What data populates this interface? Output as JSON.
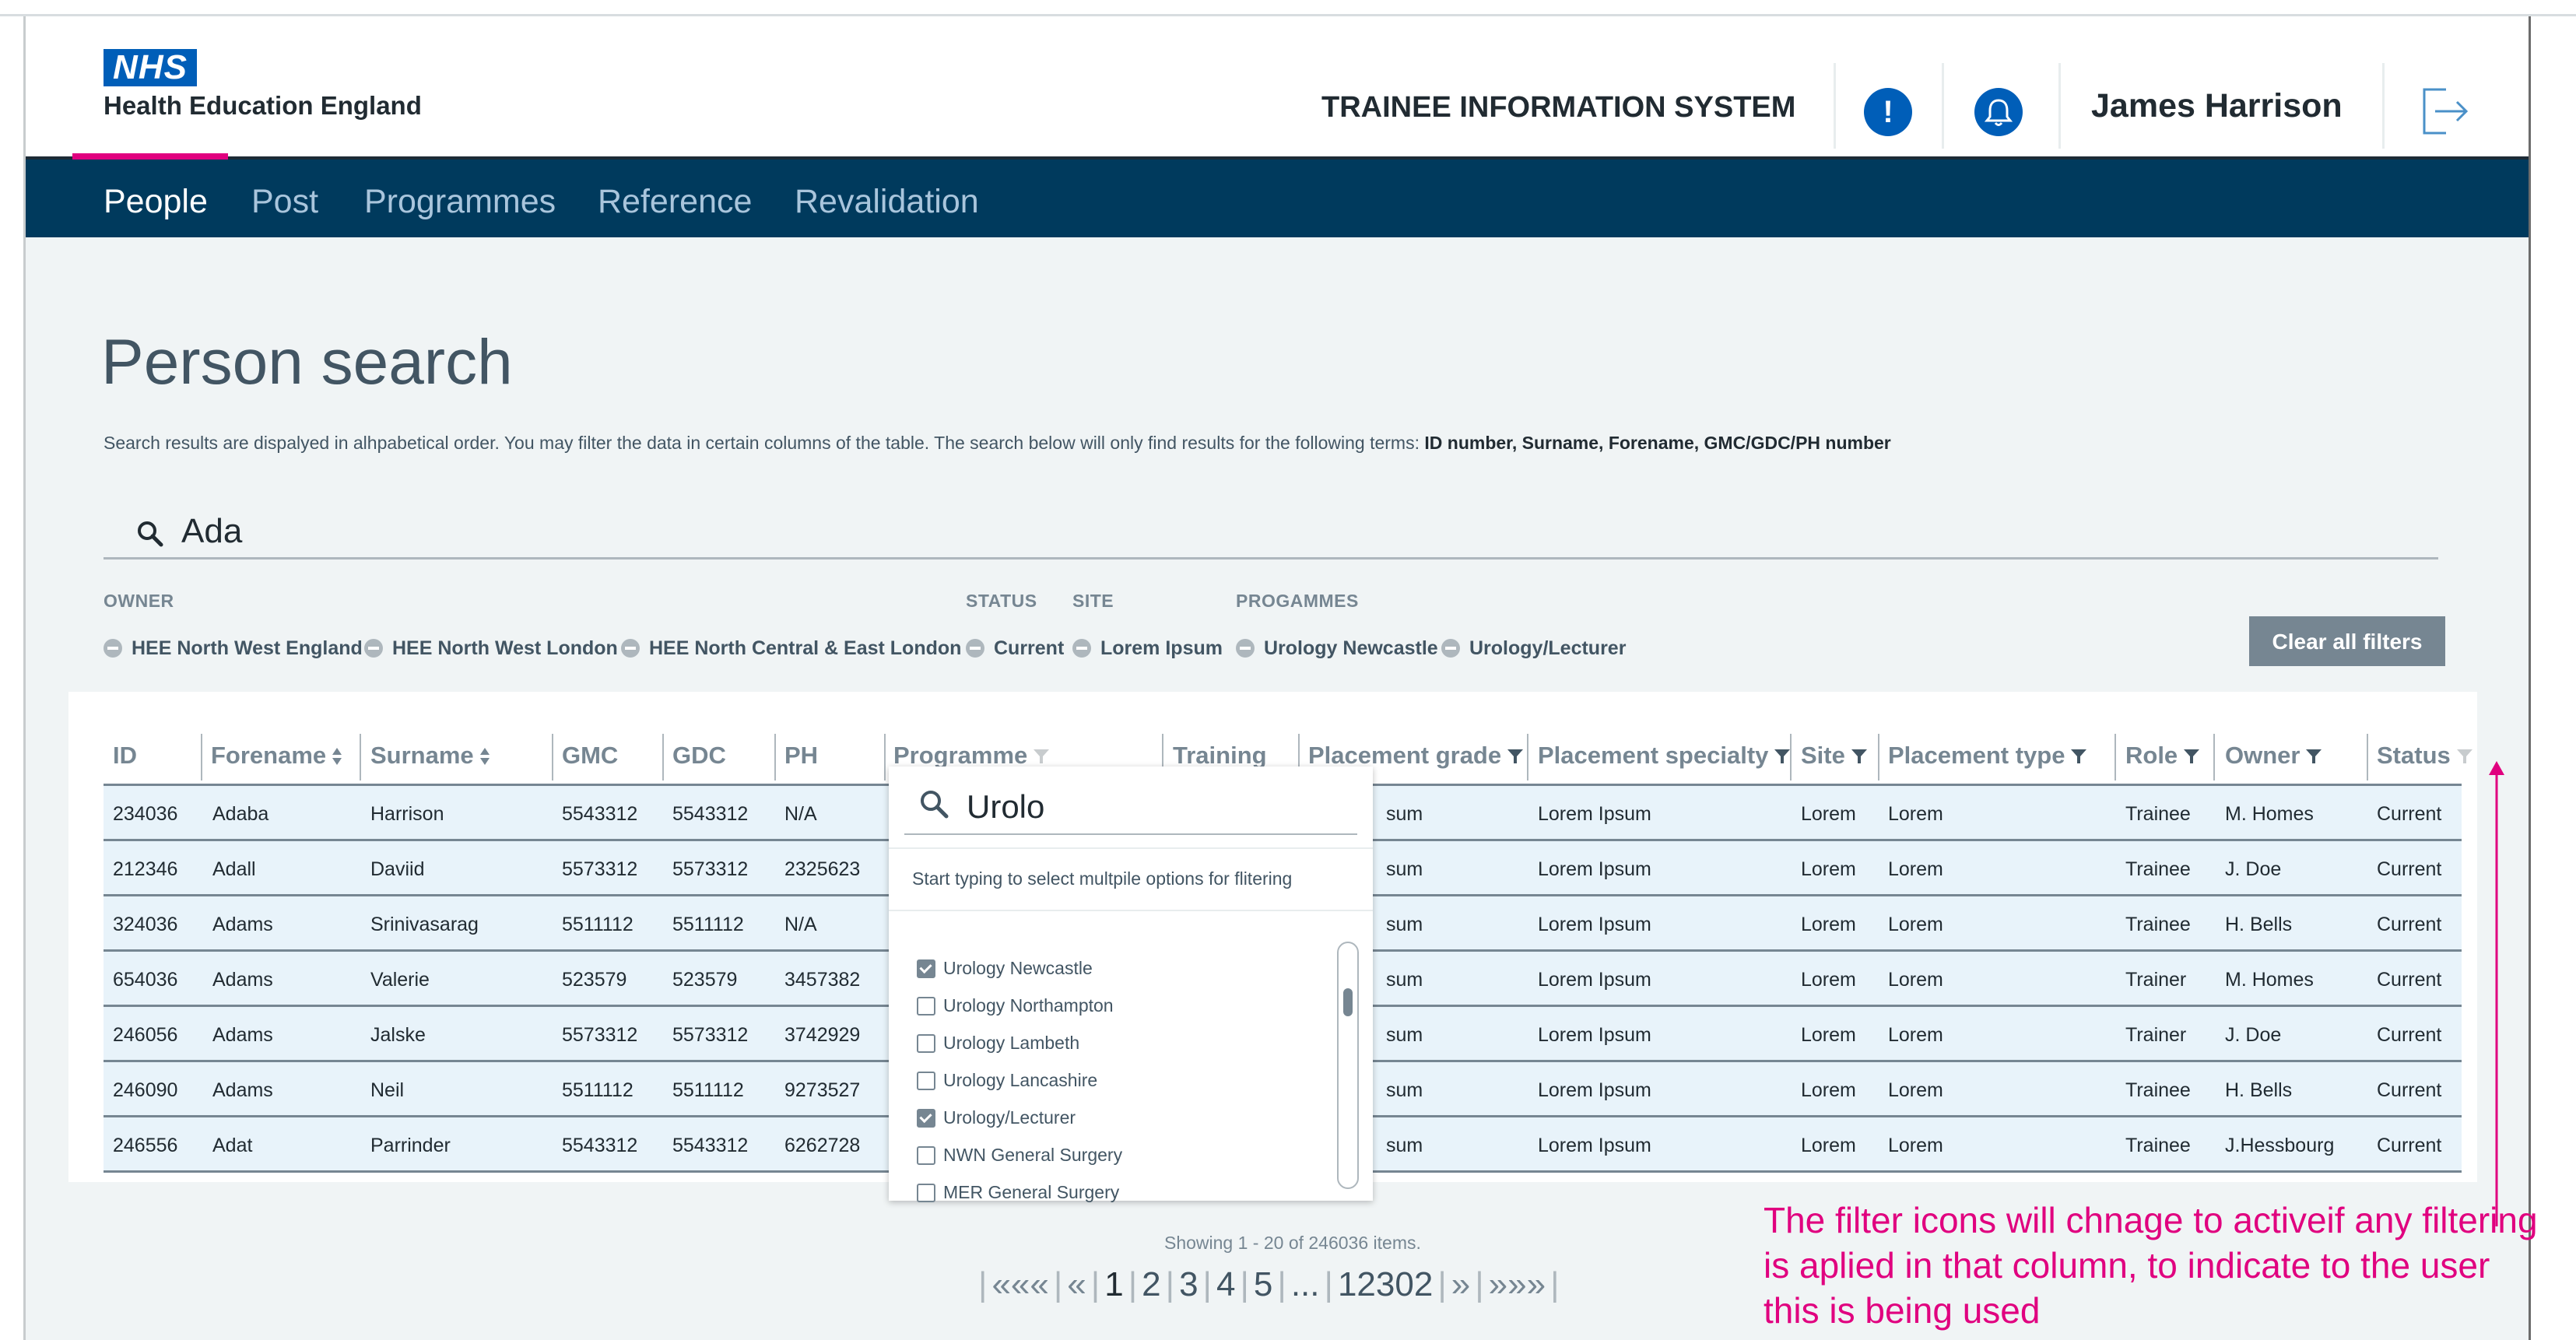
{
  "header": {
    "logo_mark": "NHS",
    "logo_org": "Health Education England",
    "app_title": "TRAINEE INFORMATION SYSTEM",
    "alert_glyph": "!",
    "user_name": "James Harrison",
    "icons": [
      "alert-icon",
      "bell-icon",
      "logout-icon"
    ]
  },
  "nav": {
    "items": [
      "People",
      "Post",
      "Programmes",
      "Reference",
      "Revalidation"
    ],
    "active": "People"
  },
  "page": {
    "title": "Person search",
    "intro_prefix": "Search results are dispalyed in alhpabetical order. You may filter the data in certain columns of the table. The search below  will only find results for the following terms: ",
    "intro_terms": "ID number, Surname, Forename, GMC/GDC/PH number"
  },
  "search": {
    "value": "Ada"
  },
  "filters": {
    "labels": {
      "owner": "OWNER",
      "status": "STATUS",
      "site": "SITE",
      "programmes": "PROGAMMES"
    },
    "chips": [
      "HEE North West England",
      "HEE North West London",
      "HEE North Central & East London",
      "Current",
      "Lorem Ipsum",
      "Urology Newcastle",
      "Urology/Lecturer"
    ],
    "clear_label": "Clear all filters"
  },
  "table": {
    "columns": [
      "ID",
      "Forename",
      "Surname",
      "GMC",
      "GDC",
      "PH",
      "Programme",
      "Training",
      "Placement grade",
      "Placement specialty",
      "Site",
      "Placement type",
      "Role",
      "Owner",
      "Status"
    ],
    "rows": [
      [
        "234036",
        "Adaba",
        "Harrison",
        "5543312",
        "5543312",
        "N/A",
        "sum",
        "Lorem Ipsum",
        "Lorem",
        "Lorem",
        "Trainee",
        "M. Homes",
        "Current"
      ],
      [
        "212346",
        "Adall",
        "Daviid",
        "5573312",
        "5573312",
        "2325623",
        "sum",
        "Lorem Ipsum",
        "Lorem",
        "Lorem",
        "Trainee",
        "J. Doe",
        "Current"
      ],
      [
        "324036",
        "Adams",
        "Srinivasarag",
        "5511112",
        "5511112",
        "N/A",
        "sum",
        "Lorem Ipsum",
        "Lorem",
        "Lorem",
        "Trainee",
        "H. Bells",
        "Current"
      ],
      [
        "654036",
        "Adams",
        "Valerie",
        "523579",
        "523579",
        "3457382",
        "sum",
        "Lorem Ipsum",
        "Lorem",
        "Lorem",
        "Trainer",
        "M. Homes",
        "Current"
      ],
      [
        "246056",
        "Adams",
        "Jalske",
        "5573312",
        "5573312",
        "3742929",
        "sum",
        "Lorem Ipsum",
        "Lorem",
        "Lorem",
        "Trainer",
        "J. Doe",
        "Current"
      ],
      [
        "246090",
        "Adams",
        "Neil",
        "5511112",
        "5511112",
        "9273527",
        "sum",
        "Lorem Ipsum",
        "Lorem",
        "Lorem",
        "Trainee",
        "H. Bells",
        "Current"
      ],
      [
        "246556",
        "Adat",
        "Parrinder",
        "5543312",
        "5543312",
        "6262728",
        "sum",
        "Lorem Ipsum",
        "Lorem",
        "Lorem",
        "Trainee",
        "J.Hessbourg",
        "Current"
      ]
    ]
  },
  "dropdown": {
    "search_value": "Urolo",
    "hint": "Start typing to select multpile options for flitering",
    "options": [
      {
        "label": "Urology Newcastle",
        "checked": true
      },
      {
        "label": "Urology Northampton",
        "checked": false
      },
      {
        "label": "Urology Lambeth",
        "checked": false
      },
      {
        "label": "Urology Lancashire",
        "checked": false
      },
      {
        "label": "Urology/Lecturer",
        "checked": true
      },
      {
        "label": "NWN General Surgery",
        "checked": false
      },
      {
        "label": "MER General Surgery",
        "checked": false
      }
    ]
  },
  "pagination": {
    "showing": "Showing 1 - 20 of 246036 items.",
    "first": "«««",
    "prev": "«",
    "pages": [
      "1",
      "2",
      "3",
      "4",
      "5",
      "...",
      "12302"
    ],
    "current": "1",
    "next": "»",
    "last": "»»»"
  },
  "annotation": {
    "text": "The filter icons will chnage to activeif any filtering is aplied in that column, to indicate to the user this is being used",
    "color": "#e0007f"
  },
  "colors": {
    "nhs_blue": "#005eb8",
    "nav_bg": "#003a5d",
    "accent": "#e0007f",
    "row_bg": "#e8f3fa"
  }
}
